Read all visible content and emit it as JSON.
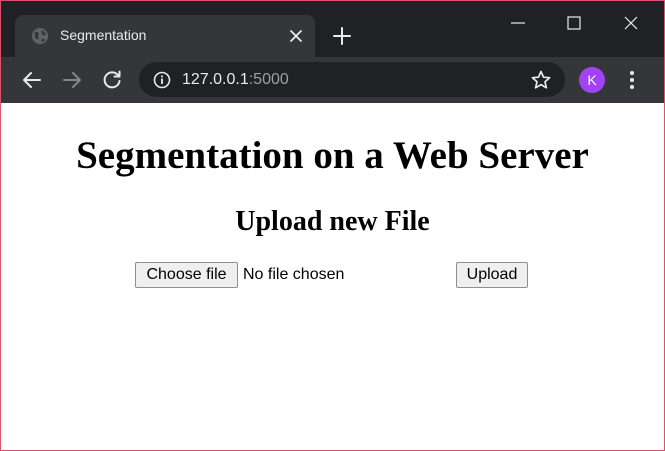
{
  "browser": {
    "tab": {
      "title": "Segmentation",
      "favicon": "globe-icon"
    },
    "address_bar": {
      "host": "127.0.0.1",
      "port": ":5000"
    },
    "profile_initial": "K",
    "colors": {
      "titlebar": "#202124",
      "toolbar": "#35363a",
      "avatar": "#a142f4",
      "text_light": "#e8eaed",
      "text_muted": "#9aa0a6"
    }
  },
  "page": {
    "title": "Segmentation on a Web Server",
    "subtitle": "Upload new File",
    "file_input": {
      "button_label": "Choose file",
      "status": "No file chosen"
    },
    "upload_label": "Upload"
  }
}
